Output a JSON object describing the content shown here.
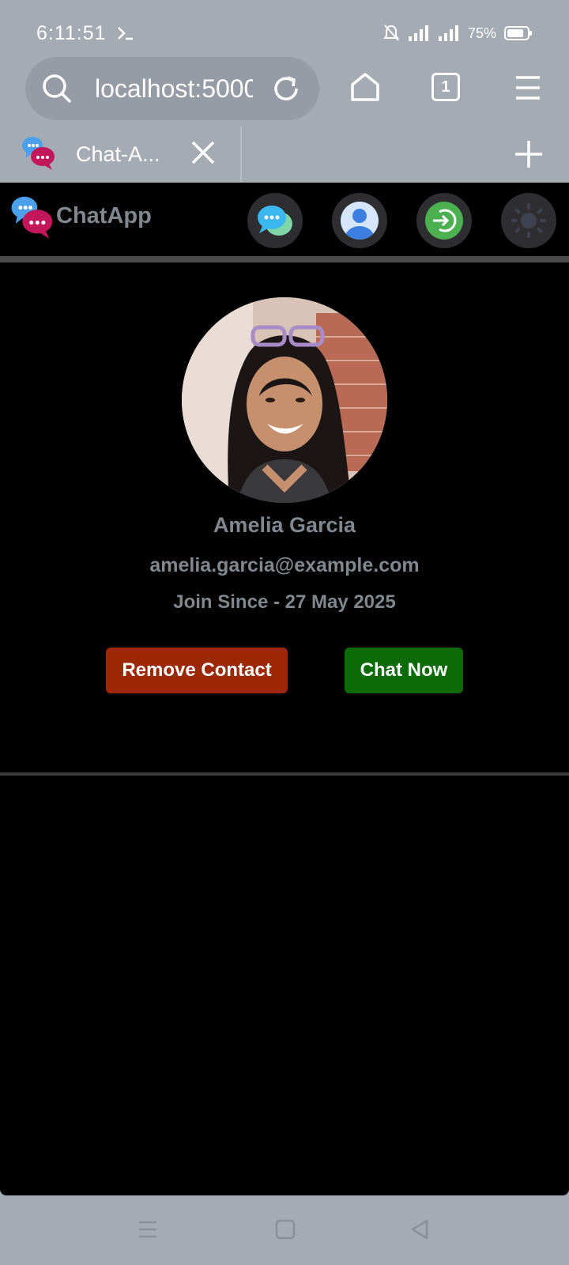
{
  "status_bar": {
    "time": "6:11:51",
    "battery_percent": "75%"
  },
  "browser": {
    "url": "localhost:5000",
    "open_tabs_count": "1",
    "tab_title": "Chat-A..."
  },
  "app": {
    "brand_name": "ChatApp",
    "nav": [
      {
        "name": "chats-icon"
      },
      {
        "name": "profile-icon"
      },
      {
        "name": "login-icon"
      },
      {
        "name": "theme-toggle-icon"
      }
    ],
    "profile": {
      "name": "Amelia Garcia",
      "email": "amelia.garcia@example.com",
      "joined": "Join Since - 27 May 2025"
    },
    "actions": {
      "remove_label": "Remove Contact",
      "chat_label": "Chat Now"
    }
  },
  "colors": {
    "app_background": "#000000",
    "remove_button": "#9c2805",
    "chat_button": "#0b6b06",
    "muted_text": "#7f878f",
    "browser_chrome": "#a4abb3"
  }
}
